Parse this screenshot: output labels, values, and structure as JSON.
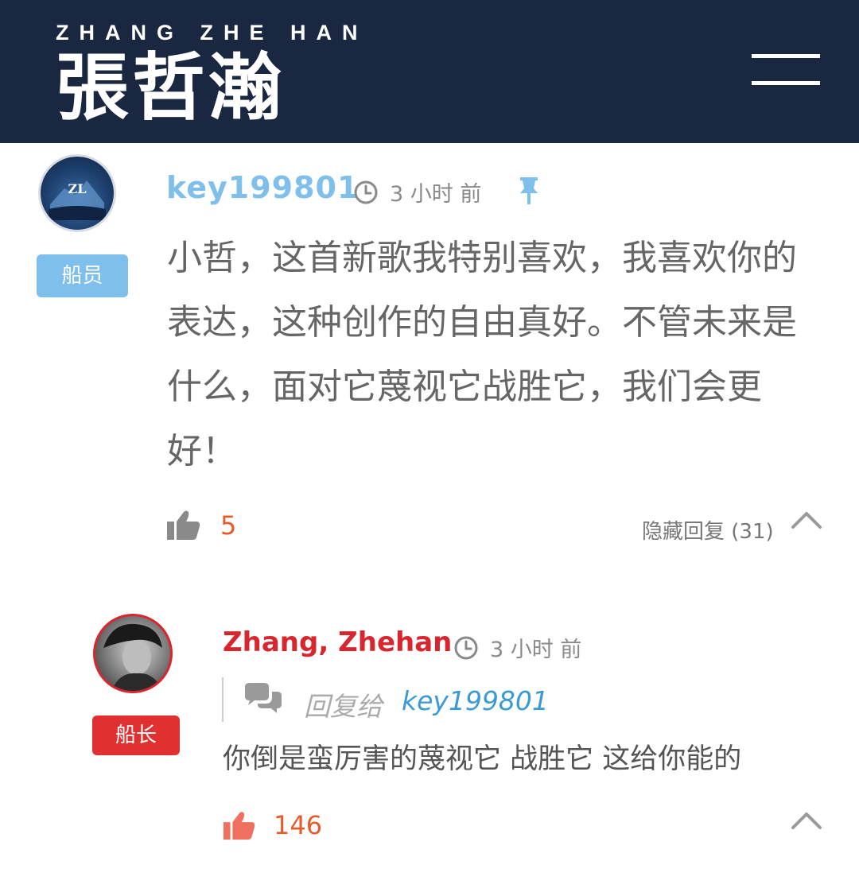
{
  "header": {
    "brand_en": "ZHANG ZHE HAN",
    "brand_cn": "張哲瀚",
    "bg_color": "#1a2740"
  },
  "comment": {
    "username": "key199801",
    "username_color": "#7fbfec",
    "badge": "船员",
    "time": "3 小时 前",
    "body": "小哲，这首新歌我特别喜欢，我喜欢你的表达，这种创作的自由真好。不管未来是什么，面对它蔑视它战胜它，我们会更好！",
    "likes": "5",
    "toggle_replies": "隐藏回复 (31)"
  },
  "reply": {
    "username": "Zhang, Zhehan",
    "username_color": "#d8262e",
    "badge": "船长",
    "time": "3 小时 前",
    "reply_to_label": "回复给",
    "reply_to_user": "key199801",
    "body": "你倒是蛮厉害的蔑视它 战胜它 这给你能的",
    "likes": "146"
  },
  "icons": {
    "menu": "hamburger-menu-icon",
    "clock": "clock-icon",
    "pin": "pin-icon",
    "like": "thumbs-up-icon",
    "collapse": "chevron-up-icon",
    "reply_bubble": "chat-bubbles-icon"
  },
  "colors": {
    "like_count": "#e85a2a",
    "badge_crew": "#7fbfec",
    "badge_captain": "#e03030",
    "reply_to_user": "#3a9ad6"
  }
}
